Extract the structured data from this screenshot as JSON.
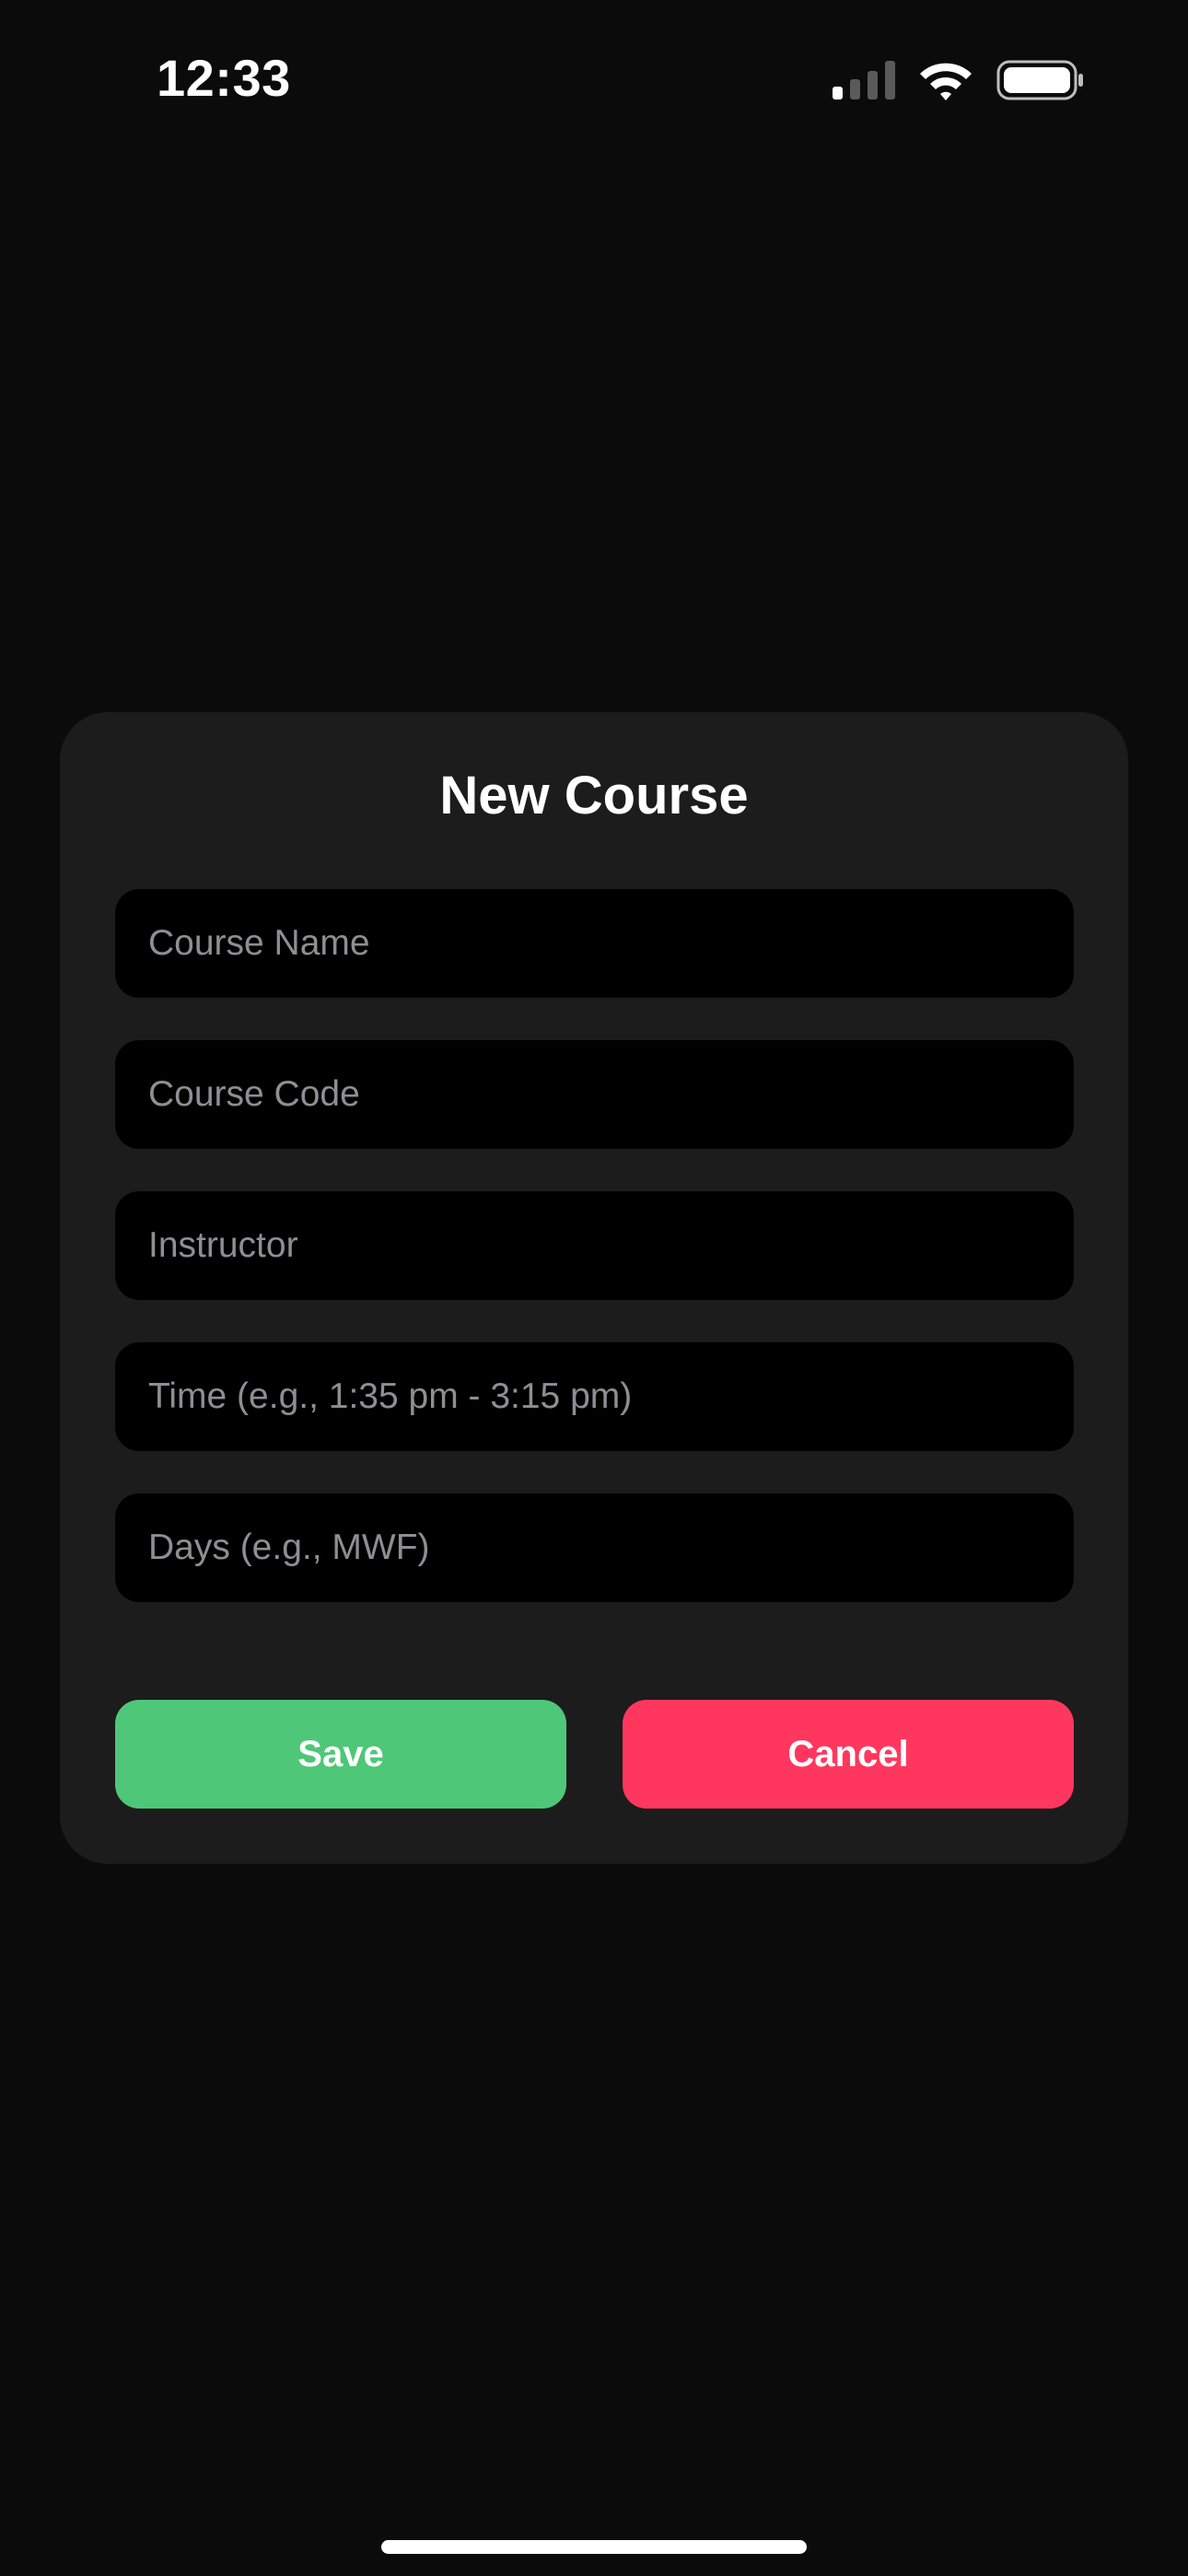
{
  "status_bar": {
    "time": "12:33",
    "signal_icon": "cellular-signal-icon",
    "wifi_icon": "wifi-icon",
    "battery_icon": "battery-icon"
  },
  "dialog": {
    "title": "New Course",
    "fields": [
      {
        "placeholder": "Course Name",
        "value": ""
      },
      {
        "placeholder": "Course Code",
        "value": ""
      },
      {
        "placeholder": "Instructor",
        "value": ""
      },
      {
        "placeholder": "Time (e.g., 1:35 pm - 3:15 pm)",
        "value": ""
      },
      {
        "placeholder": "Days (e.g., MWF)",
        "value": ""
      }
    ],
    "save_label": "Save",
    "cancel_label": "Cancel"
  },
  "colors": {
    "background": "#0b0b0b",
    "card": "#1c1c1c",
    "field": "#000000",
    "save": "#4ec778",
    "cancel": "#ff375f",
    "placeholder": "#8e8e93"
  }
}
